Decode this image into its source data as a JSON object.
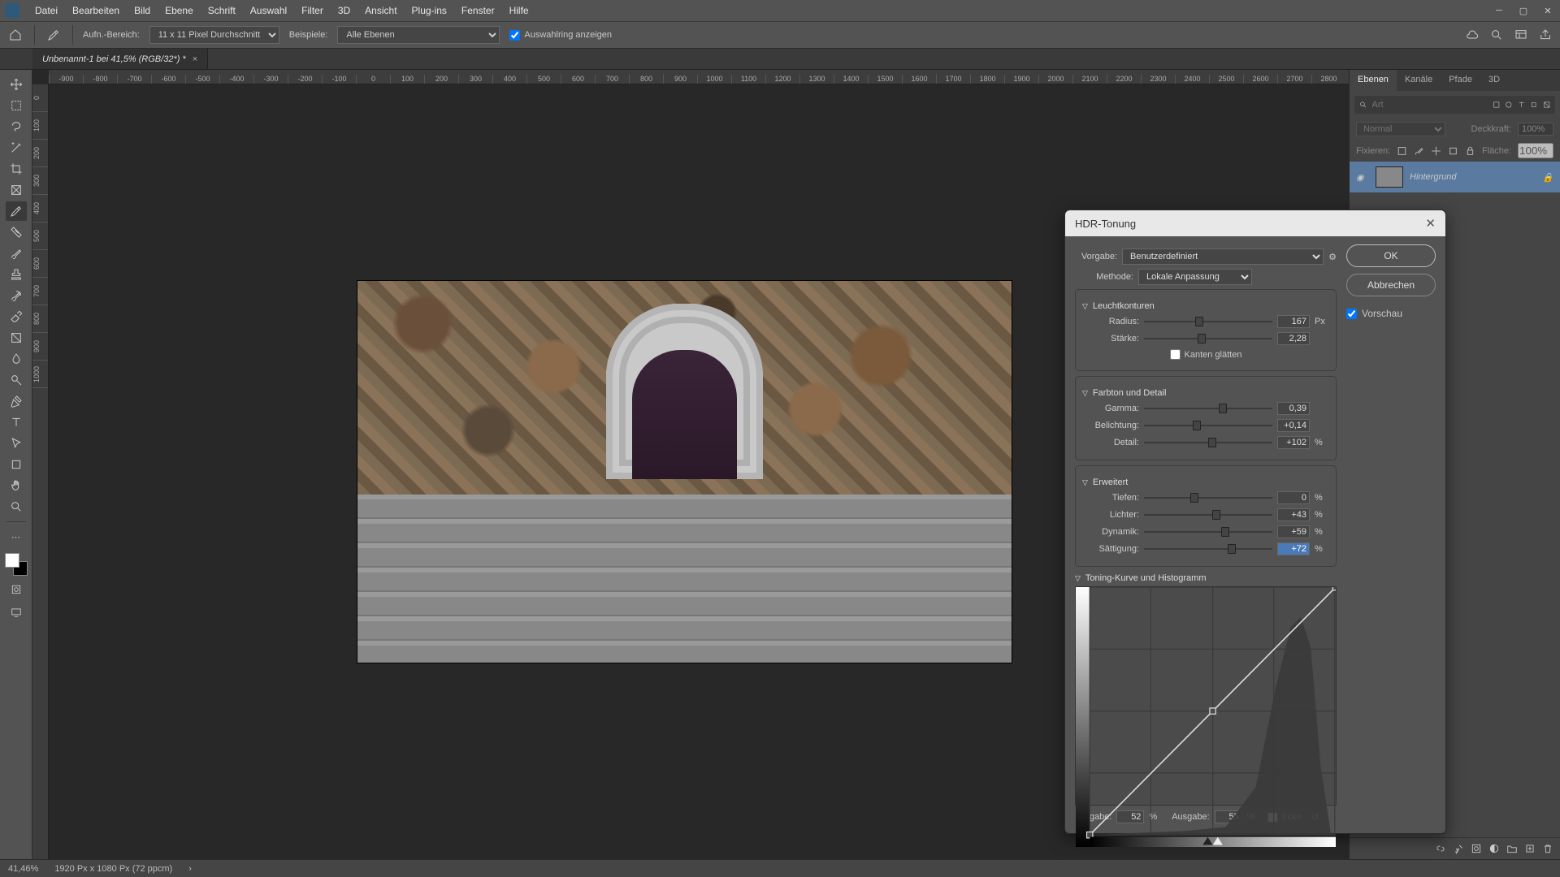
{
  "menubar": [
    "Datei",
    "Bearbeiten",
    "Bild",
    "Ebene",
    "Schrift",
    "Auswahl",
    "Filter",
    "3D",
    "Ansicht",
    "Plug-ins",
    "Fenster",
    "Hilfe"
  ],
  "options": {
    "sample_label": "Aufn.-Bereich:",
    "sample_value": "11 x 11 Pixel Durchschnitt",
    "sampletype_label": "Beispiele:",
    "sampletype_value": "Alle Ebenen",
    "show_ring": "Auswahlring anzeigen"
  },
  "doc_tab": "Unbenannt-1 bei 41,5% (RGB/32*) *",
  "ruler_h": [
    "-900",
    "-800",
    "-700",
    "-600",
    "-500",
    "-400",
    "-300",
    "-200",
    "-100",
    "0",
    "100",
    "200",
    "300",
    "400",
    "500",
    "600",
    "700",
    "800",
    "900",
    "1000",
    "1100",
    "1200",
    "1300",
    "1400",
    "1500",
    "1600",
    "1700",
    "1800",
    "1900",
    "2000",
    "2100",
    "2200",
    "2300",
    "2400",
    "2500",
    "2600",
    "2700",
    "2800"
  ],
  "ruler_v": [
    "0",
    "100",
    "200",
    "300",
    "400",
    "500",
    "600",
    "700",
    "800",
    "900",
    "1000"
  ],
  "panels": {
    "tabs": [
      "Ebenen",
      "Kanäle",
      "Pfade",
      "3D"
    ],
    "search_placeholder": "Art",
    "blend_label": "Normal",
    "opacity_label": "Deckkraft:",
    "opacity_val": "100%",
    "lock_label": "Fixieren:",
    "fill_label": "Fläche:",
    "fill_val": "100%",
    "layer_name": "Hintergrund"
  },
  "dialog": {
    "title": "HDR-Tonung",
    "preset_label": "Vorgabe:",
    "preset_value": "Benutzerdefiniert",
    "method_label": "Methode:",
    "method_value": "Lokale Anpassung",
    "ok": "OK",
    "cancel": "Abbrechen",
    "preview": "Vorschau",
    "sec_edgeglow": "Leuchtkonturen",
    "radius_label": "Radius:",
    "radius_val": "167",
    "radius_unit": "Px",
    "strength_label": "Stärke:",
    "strength_val": "2,28",
    "smooth_edges": "Kanten glätten",
    "sec_tonedetail": "Farbton und Detail",
    "gamma_label": "Gamma:",
    "gamma_val": "0,39",
    "exposure_label": "Belichtung:",
    "exposure_val": "+0,14",
    "detail_label": "Detail:",
    "detail_val": "+102",
    "detail_unit": "%",
    "sec_advanced": "Erweitert",
    "shadows_label": "Tiefen:",
    "shadows_val": "0",
    "highlights_label": "Lichter:",
    "highlights_val": "+43",
    "vibrance_label": "Dynamik:",
    "vibrance_val": "+59",
    "saturation_label": "Sättigung:",
    "saturation_val": "+72",
    "pct": "%",
    "sec_curve": "Toning-Kurve und Histogramm",
    "input_label": "Eingabe:",
    "input_val": "52",
    "output_label": "Ausgabe:",
    "output_val": "55",
    "corner_label": "Ecke",
    "slider_pos": {
      "radius": 40,
      "strength": 42,
      "gamma": 58,
      "exposure": 38,
      "detail": 50,
      "shadows": 36,
      "highlights": 53,
      "vibrance": 60,
      "saturation": 65
    }
  },
  "status": {
    "zoom": "41,46%",
    "docinfo": "1920 Px x 1080 Px (72 ppcm)"
  },
  "chart_data": {
    "type": "line",
    "title": "Toning-Kurve",
    "xlabel": "Eingabe",
    "ylabel": "Ausgabe",
    "xlim": [
      0,
      255
    ],
    "ylim": [
      0,
      255
    ],
    "series": [
      {
        "name": "curve",
        "x": [
          0,
          128,
          255
        ],
        "y": [
          0,
          132,
          255
        ]
      }
    ],
    "markers": [
      {
        "x": 128,
        "y": 132
      }
    ],
    "histogram_note": "Histogramm rechtslastig (dunkles Bild), Peak nahe 200-230"
  }
}
